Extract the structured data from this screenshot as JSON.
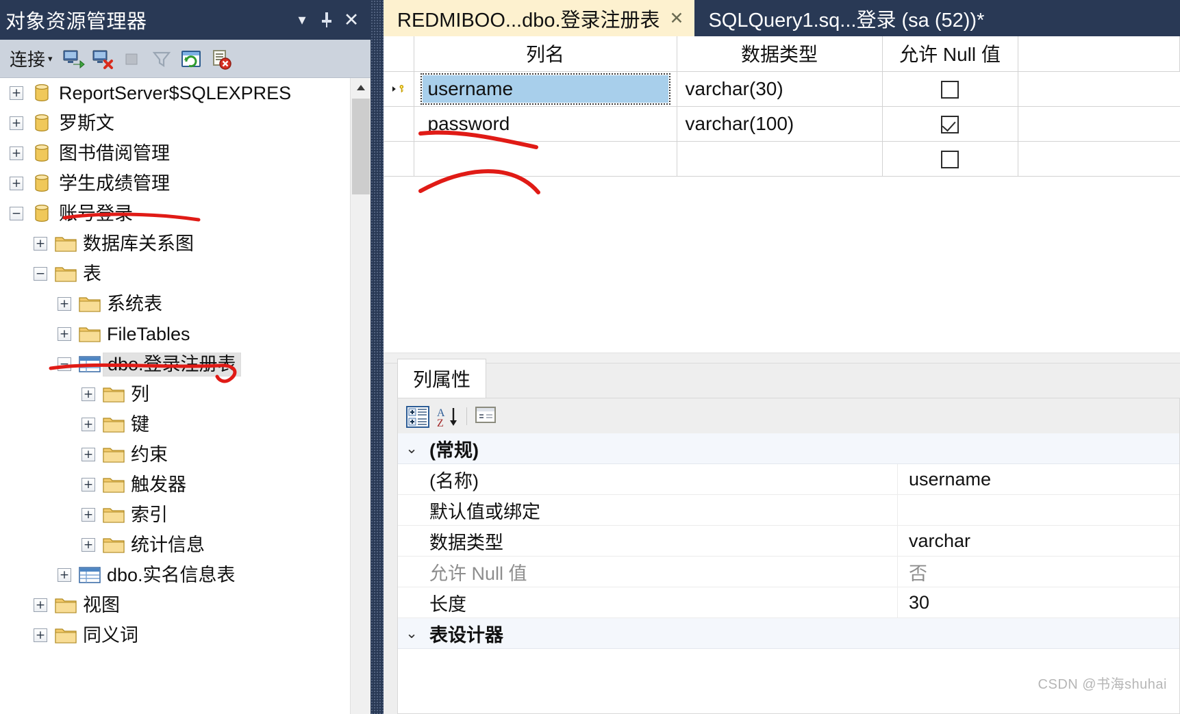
{
  "object_explorer": {
    "title": "对象资源管理器",
    "titlebar_buttons": [
      {
        "name": "dropdown-icon",
        "glyph": "▾"
      },
      {
        "name": "pin-icon",
        "glyph": "⇅"
      },
      {
        "name": "close-icon",
        "glyph": "✕"
      }
    ],
    "toolbar": {
      "connect_label": "连接",
      "connect_caret": "▾",
      "icons": [
        {
          "name": "connect-object-explorer-icon"
        },
        {
          "name": "disconnect-icon"
        },
        {
          "name": "stop-icon"
        },
        {
          "name": "filter-icon"
        },
        {
          "name": "refresh-icon"
        },
        {
          "name": "script-error-icon"
        }
      ]
    },
    "tree": [
      {
        "label": "ReportServer$SQLEXPRES",
        "icon": "database-icon",
        "expander": "+",
        "indent": 0
      },
      {
        "label": "罗斯文",
        "icon": "database-icon",
        "expander": "+",
        "indent": 0
      },
      {
        "label": "图书借阅管理",
        "icon": "database-icon",
        "expander": "+",
        "indent": 0
      },
      {
        "label": "学生成绩管理",
        "icon": "database-icon",
        "expander": "+",
        "indent": 0
      },
      {
        "label": "账号登录",
        "icon": "database-icon",
        "expander": "−",
        "indent": 0,
        "annotated": true
      },
      {
        "label": "数据库关系图",
        "icon": "folder-icon",
        "expander": "+",
        "indent": 1
      },
      {
        "label": "表",
        "icon": "folder-icon",
        "expander": "−",
        "indent": 1
      },
      {
        "label": "系统表",
        "icon": "folder-icon",
        "expander": "+",
        "indent": 2
      },
      {
        "label": "FileTables",
        "icon": "folder-icon",
        "expander": "+",
        "indent": 2
      },
      {
        "label": "dbo.登录注册表",
        "icon": "table-icon",
        "expander": "−",
        "indent": 2,
        "selected": true,
        "annotated": true
      },
      {
        "label": "列",
        "icon": "folder-icon",
        "expander": "+",
        "indent": 3
      },
      {
        "label": "键",
        "icon": "folder-icon",
        "expander": "+",
        "indent": 3
      },
      {
        "label": "约束",
        "icon": "folder-icon",
        "expander": "+",
        "indent": 3
      },
      {
        "label": "触发器",
        "icon": "folder-icon",
        "expander": "+",
        "indent": 3
      },
      {
        "label": "索引",
        "icon": "folder-icon",
        "expander": "+",
        "indent": 3
      },
      {
        "label": "统计信息",
        "icon": "folder-icon",
        "expander": "+",
        "indent": 3
      },
      {
        "label": "dbo.实名信息表",
        "icon": "table-icon",
        "expander": "+",
        "indent": 2
      },
      {
        "label": "视图",
        "icon": "folder-icon",
        "expander": "+",
        "indent": 1
      },
      {
        "label": "同义词",
        "icon": "folder-icon",
        "expander": "+",
        "indent": 1
      }
    ],
    "scrollbar": {
      "arrow_up": "︿"
    }
  },
  "tabs": [
    {
      "label": "REDMIBOO...dbo.登录注册表",
      "close": "✕",
      "active": true
    },
    {
      "label": "SQLQuery1.sq...登录 (sa (52))*",
      "close": "",
      "active": false
    }
  ],
  "designer": {
    "headers": [
      "",
      "列名",
      "数据类型",
      "允许 Null 值"
    ],
    "rows": [
      {
        "marker": "key",
        "name": "username",
        "type": "varchar(30)",
        "allow_null": false,
        "selected": true,
        "annotated": true
      },
      {
        "marker": "",
        "name": "password",
        "type": "varchar(100)",
        "allow_null": true,
        "selected": false,
        "annotated": true
      },
      {
        "marker": "",
        "name": "",
        "type": "",
        "allow_null": false,
        "selected": false,
        "annotated": false
      }
    ]
  },
  "properties": {
    "tab_label": "列属性",
    "toolbar_icons": [
      {
        "name": "categorized-view-icon"
      },
      {
        "name": "alphabetical-sort-icon"
      },
      {
        "name": "property-pages-icon"
      }
    ],
    "rows": [
      {
        "kind": "group",
        "chev": "⌄",
        "name": "(常规)",
        "value": ""
      },
      {
        "kind": "item",
        "name": "(名称)",
        "value": "username"
      },
      {
        "kind": "item",
        "name": "默认值或绑定",
        "value": ""
      },
      {
        "kind": "item",
        "name": "数据类型",
        "value": "varchar"
      },
      {
        "kind": "item",
        "name": "允许 Null 值",
        "value": "否",
        "dim": true
      },
      {
        "kind": "item",
        "name": "长度",
        "value": "30"
      },
      {
        "kind": "group",
        "chev": "⌄",
        "name": "表设计器",
        "value": ""
      }
    ]
  },
  "watermark": "CSDN @书海shuhai",
  "colors": {
    "titlebar": "#293955",
    "panel": "#ccd3dd",
    "active_tab": "#fdf1cf",
    "selection": "#a8cfeb",
    "annotation": "#e01b16"
  }
}
